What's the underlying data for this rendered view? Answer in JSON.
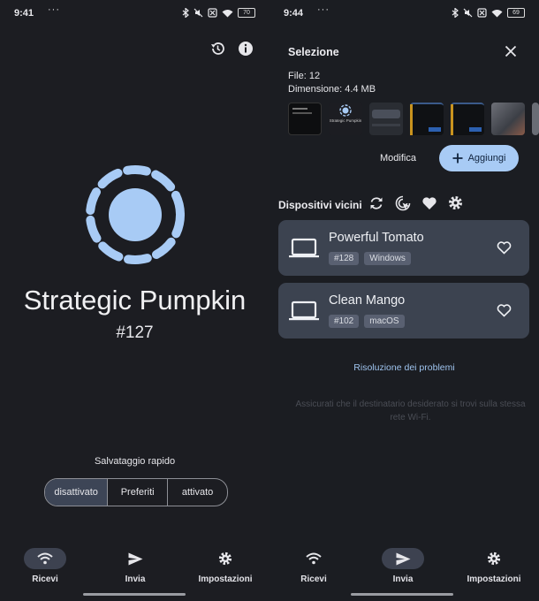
{
  "left": {
    "status": {
      "time": "9:41",
      "dots": "···",
      "battery": "70"
    },
    "device_name": "Strategic Pumpkin",
    "device_number": "#127",
    "quick_save": {
      "title": "Salvataggio rapido",
      "options": [
        "disattivato",
        "Preferiti",
        "attivato"
      ],
      "selected": "disattivato"
    },
    "nav": [
      {
        "label": "Ricevi",
        "icon": "wifi-icon",
        "active": true
      },
      {
        "label": "Invia",
        "icon": "send-icon",
        "active": false
      },
      {
        "label": "Impostazioni",
        "icon": "gear-icon",
        "active": false
      }
    ]
  },
  "right": {
    "status": {
      "time": "9:44",
      "dots": "···",
      "battery": "69"
    },
    "selection": {
      "title": "Selezione",
      "files": "File: 12",
      "size": "Dimensione: 4.4 MB",
      "thumb_caption": "Strategic Pumpkin"
    },
    "edit_label": "Modifica",
    "add_label": "Aggiungi",
    "nearby_title": "Dispositivi vicini",
    "devices": [
      {
        "name": "Powerful Tomato",
        "number": "#128",
        "os": "Windows"
      },
      {
        "name": "Clean Mango",
        "number": "#102",
        "os": "macOS"
      }
    ],
    "troubleshoot": "Risoluzione dei problemi",
    "hint": "Assicurati che il destinatario desiderato si trovi sulla stessa rete Wi-Fi.",
    "nav": [
      {
        "label": "Ricevi",
        "icon": "wifi-icon",
        "active": false
      },
      {
        "label": "Invia",
        "icon": "send-icon",
        "active": true
      },
      {
        "label": "Impostazioni",
        "icon": "gear-icon",
        "active": false
      }
    ]
  },
  "colors": {
    "accent": "#a8cbf5",
    "background": "#1c1d22",
    "card": "#3c4350"
  }
}
